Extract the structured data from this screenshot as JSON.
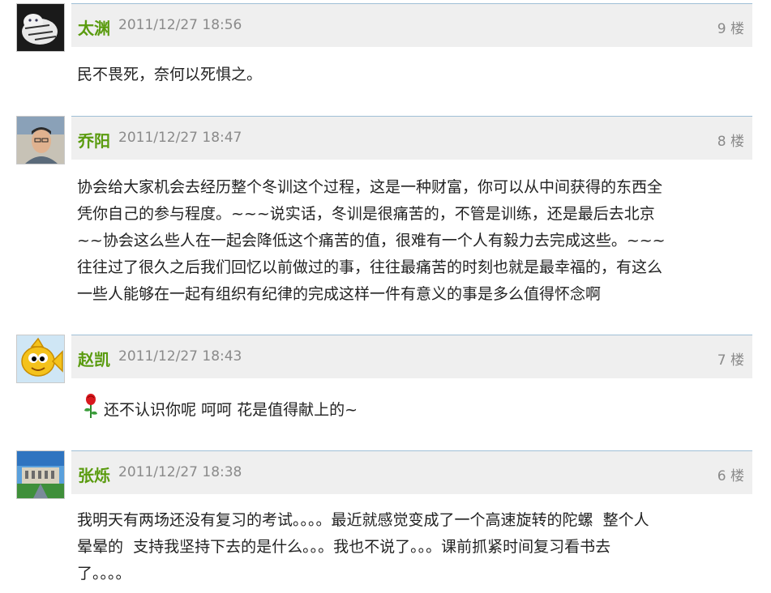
{
  "posts": [
    {
      "user": "太渊",
      "time": "2011/12/27 18:56",
      "floor": "9 楼",
      "content": "民不畏死，奈何以死惧之。",
      "avatar": "tiger-avatar"
    },
    {
      "user": "乔阳",
      "time": "2011/12/27 18:47",
      "floor": "8 楼",
      "content_lines": [
        "协会给大家机会去经历整个冬训这个过程，这是一种财富，你可以从中间获得的东西全",
        "凭你自己的参与程度。~~~说实话，冬训是很痛苦的，不管是训练，还是最后去北京",
        "~~协会这么些人在一起会降低这个痛苦的值，很难有一个人有毅力去完成这些。~~~",
        "往往过了很久之后我们回忆以前做过的事，往往最痛苦的时刻也就是最幸福的，有这么",
        "一些人能够在一起有组织有纪律的完成这样一件有意义的事是多么值得怀念啊"
      ],
      "avatar": "man-photo-avatar"
    },
    {
      "user": "赵凯",
      "time": "2011/12/27 18:43",
      "floor": "7 楼",
      "content": "还不认识你呢 呵呵 花是值得献上的~",
      "avatar": "yellow-fish-avatar",
      "emoticon": "rose-icon"
    },
    {
      "user": "张烁",
      "time": "2011/12/27 18:38",
      "floor": "6 楼",
      "content_lines": [
        "我明天有两场还没有复习的考试。。。。最近就感觉变成了一个高速旋转的陀螺  整个人",
        "晕晕的  支持我坚持下去的是什么。。。我也不说了。。。课前抓紧时间复习看书去",
        "了。。。。"
      ],
      "avatar": "building-avatar"
    }
  ],
  "colors": {
    "username": "#5a9b0f",
    "meta": "#8a8a8a",
    "header_bg": "#efefef",
    "header_border": "#9fbfd6"
  }
}
